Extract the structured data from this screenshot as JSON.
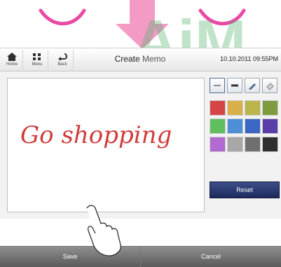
{
  "header": {
    "home_label": "Home",
    "menu_label": "Menu",
    "back_label": "Back",
    "title_part1": "Create ",
    "title_part2": "Memo",
    "datetime": "10.10.2011 09:55PM"
  },
  "canvas": {
    "handwriting_text": "Go shopping"
  },
  "toolbox": {
    "tools": [
      "thin-line-icon",
      "thick-line-icon",
      "pencil-icon",
      "eraser-icon"
    ],
    "colors": [
      "#d64545",
      "#d8b04a",
      "#b9b54a",
      "#7f9b3f",
      "#5fbf5f",
      "#4d8ed6",
      "#3b66c4",
      "#5a3fa8",
      "#b06ad0",
      "#a7a7a7",
      "#6f6f6f",
      "#2f2f2f"
    ],
    "reset_label": "Reset"
  },
  "footer": {
    "save_label": "Save",
    "cancel_label": "Cancel"
  }
}
